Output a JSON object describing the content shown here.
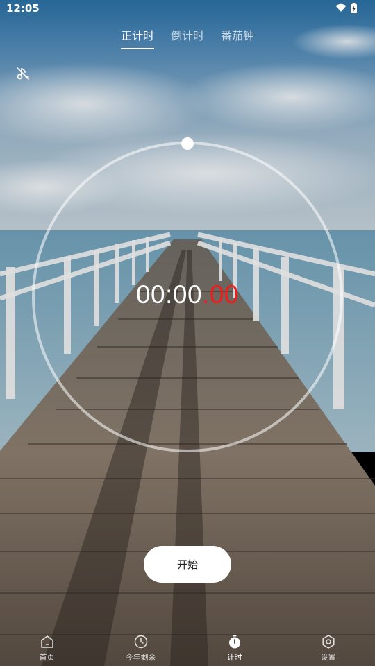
{
  "status_bar": {
    "time": "12:05"
  },
  "tabs": [
    {
      "label": "正计时",
      "active": true
    },
    {
      "label": "倒计时",
      "active": false
    },
    {
      "label": "番茄钟",
      "active": false
    }
  ],
  "timer": {
    "minutes": "00",
    "sep1": ":",
    "seconds": "00",
    "centis": ".00"
  },
  "start_button": {
    "label": "开始"
  },
  "nav": [
    {
      "label": "首页",
      "icon": "home-icon",
      "active": false
    },
    {
      "label": "今年剩余",
      "icon": "clock-icon",
      "active": false
    },
    {
      "label": "计时",
      "icon": "stopwatch-icon",
      "active": true
    },
    {
      "label": "设置",
      "icon": "settings-icon",
      "active": false
    }
  ],
  "colors": {
    "accent": "#ee1c1c",
    "text": "#ffffff",
    "button_bg": "#ffffff"
  }
}
